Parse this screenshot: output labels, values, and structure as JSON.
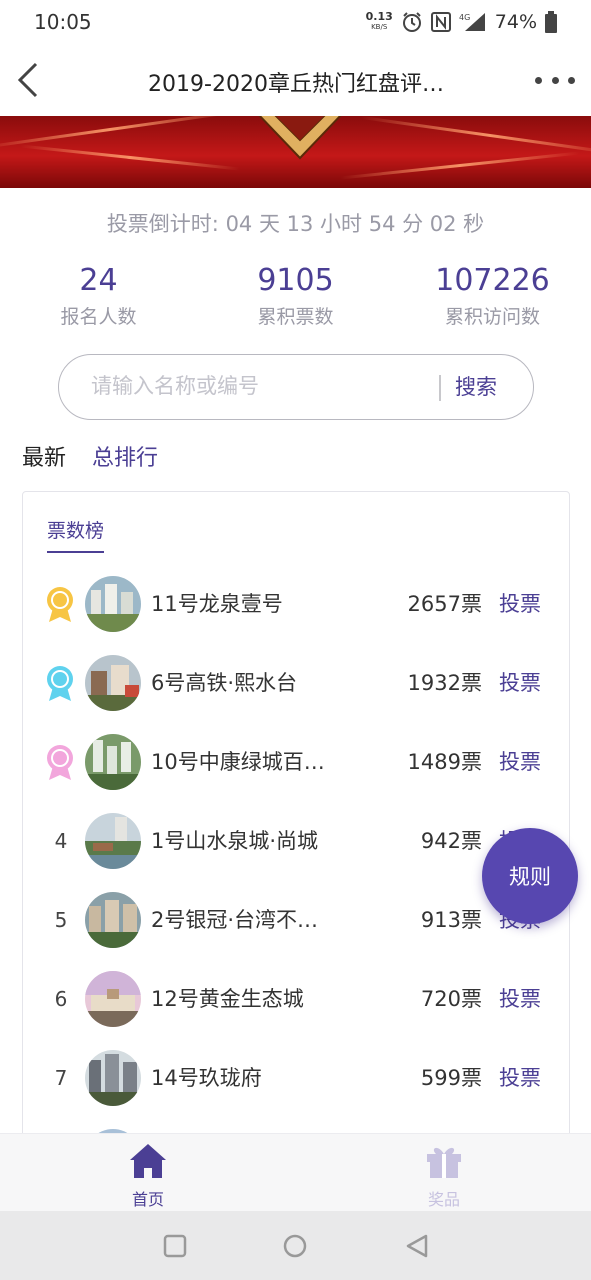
{
  "status_bar": {
    "time": "10:05",
    "net_speed": "0.13",
    "net_unit": "KB/S",
    "network": "4G",
    "battery": "74%"
  },
  "nav": {
    "title": "2019-2020章丘热门红盘评…"
  },
  "countdown": "投票倒计时: 04 天 13 小时 54 分 02 秒",
  "stats": [
    {
      "value": "24",
      "label": "报名人数"
    },
    {
      "value": "9105",
      "label": "累积票数"
    },
    {
      "value": "107226",
      "label": "累积访问数"
    }
  ],
  "search": {
    "placeholder": "请输入名称或编号",
    "value": "",
    "button": "搜索"
  },
  "tabs": {
    "newest": "最新",
    "total_rank": "总排行"
  },
  "ranking": {
    "title": "票数榜",
    "vote_label": "投票",
    "items": [
      {
        "rank": "1",
        "name": "11号龙泉壹号",
        "votes": "2657票",
        "medal": "gold"
      },
      {
        "rank": "2",
        "name": "6号高铁·熙水台",
        "votes": "1932票",
        "medal": "cyan"
      },
      {
        "rank": "3",
        "name": "10号中康绿城百…",
        "votes": "1489票",
        "medal": "pink"
      },
      {
        "rank": "4",
        "name": "1号山水泉城·尚城",
        "votes": "942票",
        "medal": ""
      },
      {
        "rank": "5",
        "name": "2号银冠·台湾不…",
        "votes": "913票",
        "medal": ""
      },
      {
        "rank": "6",
        "name": "12号黄金生态城",
        "votes": "720票",
        "medal": ""
      },
      {
        "rank": "7",
        "name": "14号玖珑府",
        "votes": "599票",
        "medal": ""
      }
    ]
  },
  "rules_button": "规则",
  "tabbar": {
    "home": "首页",
    "prize": "奖品"
  },
  "colors": {
    "accent": "#4b3f94",
    "rules_bg": "#5747b0",
    "medal_gold": "#f7c544",
    "medal_cyan": "#5fd2ee",
    "medal_pink": "#f2a6dc"
  }
}
